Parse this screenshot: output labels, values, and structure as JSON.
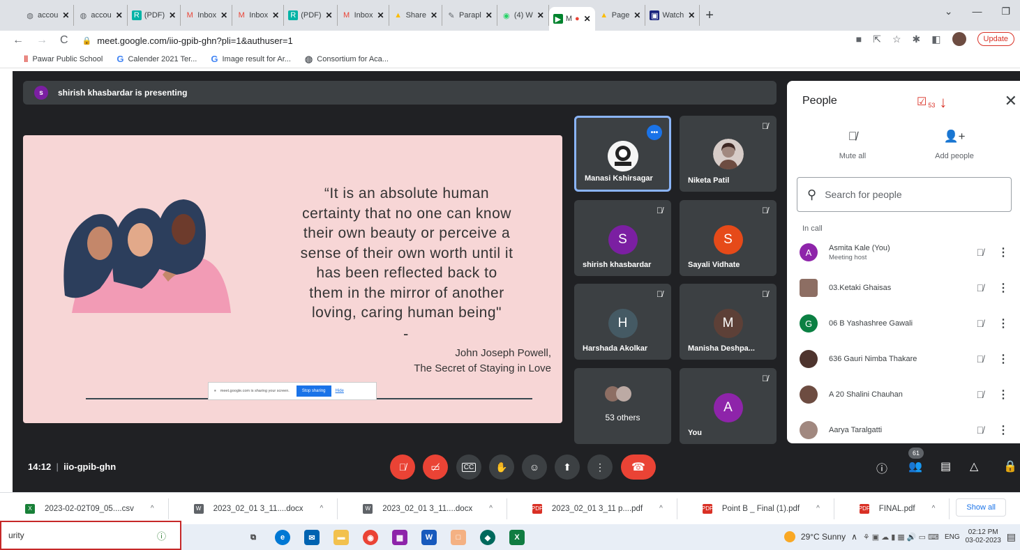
{
  "browser": {
    "tabs": [
      {
        "label": "accou",
        "icon": "globe-icon",
        "color": "#5f6368"
      },
      {
        "label": "accou",
        "icon": "globe-icon",
        "color": "#5f6368"
      },
      {
        "label": "(PDF)",
        "icon": "researchgate-icon",
        "color": "#00b3a6"
      },
      {
        "label": "Inbox",
        "icon": "gmail-icon",
        "color": "#ea4335"
      },
      {
        "label": "Inbox",
        "icon": "gmail-icon",
        "color": "#ea4335"
      },
      {
        "label": "(PDF)",
        "icon": "researchgate-icon",
        "color": "#00b3a6"
      },
      {
        "label": "Inbox",
        "icon": "gmail-icon",
        "color": "#ea4335"
      },
      {
        "label": "Share",
        "icon": "drive-icon",
        "color": "#fbbc04"
      },
      {
        "label": "Parapl",
        "icon": "quill-icon",
        "color": "#5f6368"
      },
      {
        "label": "(4) W",
        "icon": "whatsapp-icon",
        "color": "#25d366"
      },
      {
        "label": "M",
        "icon": "meet-icon",
        "color": "#00832d",
        "active": true
      },
      {
        "label": "Page",
        "icon": "drive-icon",
        "color": "#fbbc04"
      },
      {
        "label": "Watch",
        "icon": "watch-icon",
        "color": "#1a237e"
      }
    ],
    "new_tab": "+",
    "url": "meet.google.com/iio-gpib-ghn?pli=1&authuser=1",
    "update_label": "Update",
    "bookmarks": [
      {
        "label": "Pawar Public School",
        "icon": "bars-icon"
      },
      {
        "label": "Calender 2021 Ter...",
        "icon": "google-icon"
      },
      {
        "label": "Image result for Ar...",
        "icon": "google-icon"
      },
      {
        "label": "Consortium for Aca...",
        "icon": "globe-icon"
      }
    ]
  },
  "meet": {
    "presenting_initial": "s",
    "presenting_text": "shirish khasbardar is presenting",
    "slide": {
      "quote_lines": [
        "“It is an absolute human",
        "certainty that no one can know",
        "their own  beauty or perceive a",
        "sense of  their own worth until it",
        "has been reflected back to",
        "them in the  mirror of another",
        "loving, caring  human being\""
      ],
      "dash": "-",
      "author_name": "John Joseph Powell,",
      "author_book": "The Secret of Staying in Love",
      "share_banner_text": "meet.google.com is sharing your screen.",
      "stop_sharing": "Stop sharing",
      "hide": "Hide"
    },
    "tiles": [
      {
        "name": "Manasi Kshirsagar",
        "type": "photo-logo",
        "highlight": true,
        "more": "•••"
      },
      {
        "name": "Niketa Patil",
        "type": "photo"
      },
      {
        "name": "shirish khasbardar",
        "initial": "S",
        "color": "#7b1fa2"
      },
      {
        "name": "Sayali Vidhate",
        "initial": "S",
        "color": "#e64a19"
      },
      {
        "name": "Harshada Akolkar",
        "initial": "H",
        "color": "#455a64"
      },
      {
        "name": "Manisha Deshpa...",
        "initial": "M",
        "color": "#5d4037"
      },
      {
        "name": "53 others",
        "type": "others"
      },
      {
        "name": "You",
        "initial": "A",
        "color": "#8e24aa"
      }
    ],
    "meeting_time": "14:12",
    "meeting_code": "iio-gpib-ghn",
    "people_badge": "61"
  },
  "people_panel": {
    "title": "People",
    "annotation_count": "53",
    "mute_all": "Mute all",
    "add_people": "Add people",
    "search_placeholder": "Search for people",
    "in_call": "In call",
    "participants": [
      {
        "name": "Asmita Kale (You)",
        "sub": "Meeting host",
        "initial": "A",
        "color": "#8e24aa"
      },
      {
        "name": "03.Ketaki Ghaisas",
        "photo": "#8d6e63"
      },
      {
        "name": "06 B Yashashree Gawali",
        "initial": "G",
        "color": "#0b8043"
      },
      {
        "name": "636 Gauri Nimba Thakare",
        "photo": "#4e342e"
      },
      {
        "name": "A 20 Shalini Chauhan",
        "photo": "#6d4c41"
      },
      {
        "name": "Aarya Taralgatti",
        "photo": "#a1887f"
      }
    ]
  },
  "downloads": {
    "items": [
      {
        "name": "2023-02-02T09_05....csv",
        "type": "csv",
        "color": "#188038"
      },
      {
        "name": "2023_02_01 3_11....docx",
        "type": "docx",
        "color": "#5f6368"
      },
      {
        "name": "2023_02_01 3_11....docx",
        "type": "docx",
        "color": "#5f6368"
      },
      {
        "name": "2023_02_01 3_11 p....pdf",
        "type": "pdf",
        "color": "#d93025"
      },
      {
        "name": "Point B _ Final (1).pdf",
        "type": "pdf",
        "color": "#d93025"
      },
      {
        "name": "FINAL.pdf",
        "type": "pdf",
        "color": "#d93025"
      }
    ],
    "show_all": "Show all"
  },
  "taskbar": {
    "search_text": "urity",
    "weather": "29°C  Sunny",
    "lang": "ENG",
    "time": "02:12 PM",
    "date": "03-02-2023"
  }
}
